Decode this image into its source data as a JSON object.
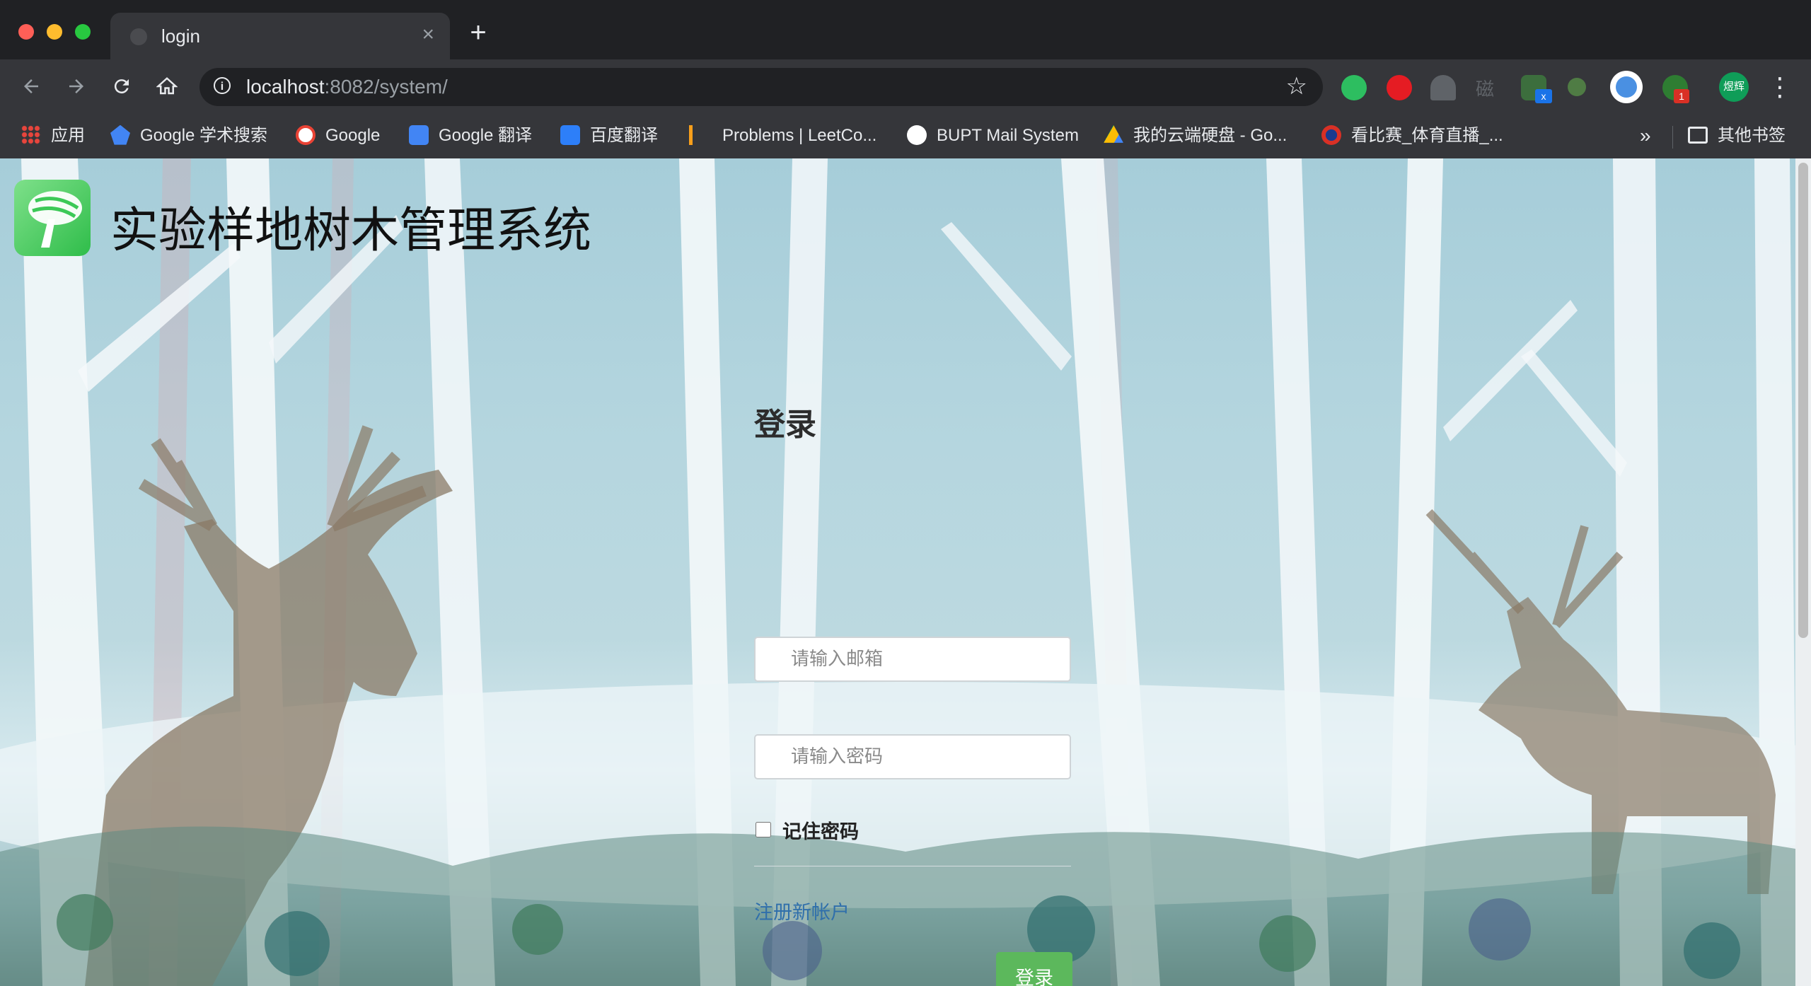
{
  "browser": {
    "tab_title": "login",
    "tab_close": "×",
    "new_tab": "+",
    "url_host": "localhost",
    "url_port_path": ":8082/system/",
    "profile_label": "煜辉",
    "extension_badges": {
      "car": "x",
      "leaf": "1"
    },
    "bookmarks": [
      {
        "label": "应用",
        "icon": "apps-grid-icon",
        "color": "#e8453c"
      },
      {
        "label": "Google 学术搜索",
        "icon": "scholar-icon",
        "color": "#4285f4"
      },
      {
        "label": "Google",
        "icon": "google-icon",
        "color": "#ffffff"
      },
      {
        "label": "Google 翻译",
        "icon": "translate-icon",
        "color": "#4285f4"
      },
      {
        "label": "百度翻译",
        "icon": "baidu-translate-icon",
        "color": "#2d7ff9"
      },
      {
        "label": "Problems | LeetCo...",
        "icon": "leetcode-icon",
        "color": "#f89f1b"
      },
      {
        "label": "BUPT Mail System",
        "icon": "globe-icon",
        "color": "#ffffff"
      },
      {
        "label": "我的云端硬盘 - Go...",
        "icon": "drive-icon",
        "color": "#0f9d58"
      },
      {
        "label": "看比赛_体育直播_...",
        "icon": "sports-icon",
        "color": "#d93025"
      }
    ],
    "bookmarks_more": "»",
    "other_bookmarks": "其他书签"
  },
  "app": {
    "title": "实验样地树木管理系统",
    "logo_icon": "tree-logo-icon",
    "logo_color": "#3cc957"
  },
  "login": {
    "heading": "登录",
    "email_placeholder": "请输入邮箱",
    "password_placeholder": "请输入密码",
    "remember_label": "记住密码",
    "remember_checked": false,
    "register_link": "注册新帐户",
    "submit_label": "登录",
    "submit_color": "#5cb85c"
  }
}
